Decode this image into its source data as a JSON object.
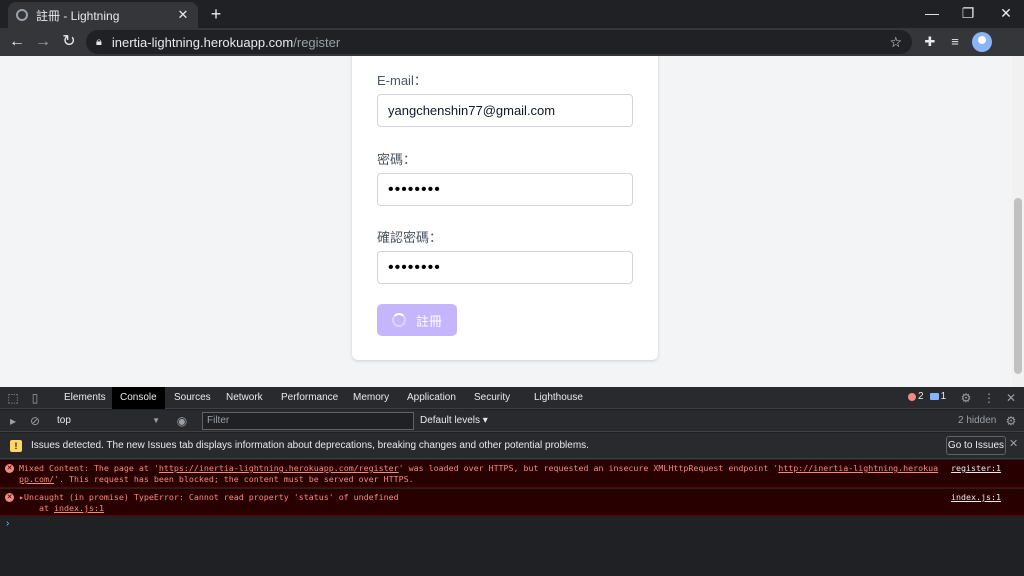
{
  "browser": {
    "tab_title": "註冊 - Lightning",
    "tab_close": "✕",
    "new_tab": "+",
    "url_host": "inertia-lightning.herokuapp.com",
    "url_path": "/register",
    "window_controls": {
      "minimize": "—",
      "maximize": "❐",
      "close": "✕"
    }
  },
  "form": {
    "email_label": "E-mail：",
    "email_value": "yangchenshin77@gmail.com",
    "password_label": "密碼：",
    "password_value": "••••••••",
    "confirm_label": "確認密碼：",
    "confirm_value": "••••••••",
    "submit_label": "註冊",
    "accent_color": "#c4b5fd"
  },
  "devtools": {
    "tabs": [
      "Elements",
      "Console",
      "Sources",
      "Network",
      "Performance",
      "Memory",
      "Application",
      "Security",
      "Lighthouse"
    ],
    "active_tab": "Console",
    "error_count": "2",
    "message_count": "1",
    "context": "top",
    "filter_placeholder": "Filter",
    "levels": "Default levels ▾",
    "hidden": "2 hidden",
    "issues_text": "Issues detected. The new Issues tab displays information about deprecations, breaking changes and other potential problems.",
    "goto_issues": "Go to Issues",
    "errors": [
      {
        "text_a": "Mixed Content: The page at '",
        "link_a": "https://inertia-lightning.herokuapp.com/register",
        "text_b": "' was loaded over HTTPS, but requested an insecure XMLHttpRequest endpoint '",
        "link_b": "http://inertia-lightning.herokuapp.com/",
        "text_c": "'. This request has been blocked; the content must be served over HTTPS.",
        "source": "register:1"
      },
      {
        "text_a": "▸Uncaught (in promise) TypeError: Cannot read property 'status' of undefined",
        "text_b": "    at ",
        "link_b": "index.js:1",
        "source": "index.js:1"
      }
    ]
  }
}
